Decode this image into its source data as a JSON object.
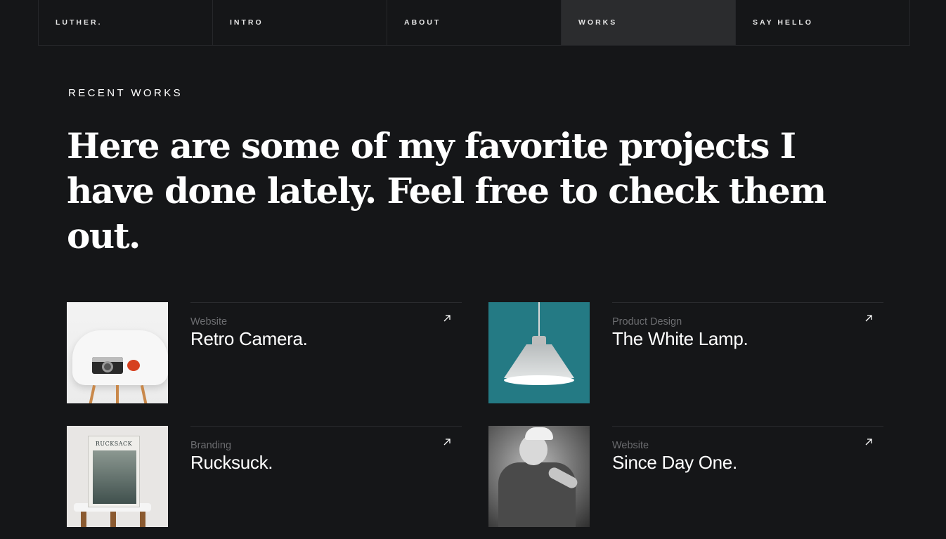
{
  "nav": {
    "items": [
      {
        "label": "LUTHER.",
        "active": false
      },
      {
        "label": "INTRO",
        "active": false
      },
      {
        "label": "ABOUT",
        "active": false
      },
      {
        "label": "WORKS",
        "active": true
      },
      {
        "label": "SAY HELLO",
        "active": false
      }
    ]
  },
  "hero": {
    "eyebrow": "RECENT WORKS",
    "headline": "Here are some of my favorite projects I have done lately. Feel free to check them out."
  },
  "works": [
    {
      "category": "Website",
      "title": "Retro Camera.",
      "image": "retro-camera-photo",
      "arrow_icon": "arrow-up-right-icon"
    },
    {
      "category": "Product Design",
      "title": "The White Lamp.",
      "image": "white-lamp-photo",
      "arrow_icon": "arrow-up-right-icon"
    },
    {
      "category": "Branding",
      "title": "Rucksuck.",
      "image": "rucksack-book-photo",
      "book_cover_text": "RUCKSACK",
      "arrow_icon": "arrow-up-right-icon"
    },
    {
      "category": "Website",
      "title": "Since Day One.",
      "image": "portrait-photo",
      "arrow_icon": "arrow-up-right-icon"
    }
  ],
  "colors": {
    "background": "#151618",
    "nav_active": "#2b2c2e",
    "border": "#26272a",
    "category_text": "#6c6d70",
    "text": "#ffffff"
  }
}
